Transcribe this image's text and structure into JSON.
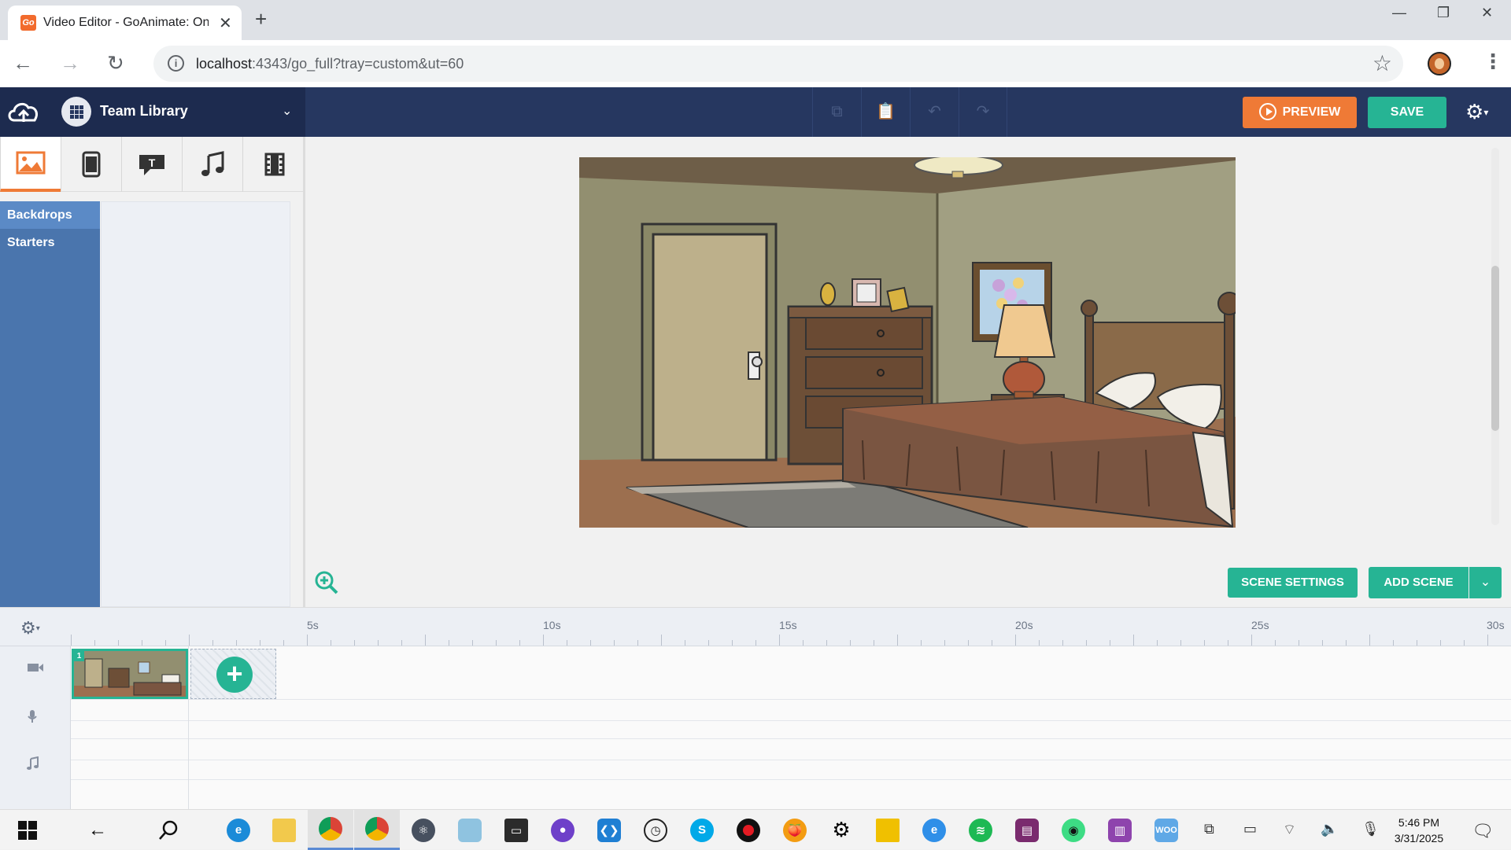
{
  "browser": {
    "tab_title": "Video Editor - GoAnimate: Online Animation",
    "favicon_text": "Go",
    "url_host": "localhost",
    "url_rest": ":4343/go_full?tray=custom&ut=60"
  },
  "header": {
    "library_title": "Team Library",
    "preview_label": "PREVIEW",
    "save_label": "SAVE",
    "colors": {
      "preview": "#ef7a36",
      "save": "#26b494",
      "header_bg": "#263760"
    }
  },
  "asset_panel": {
    "tabs": [
      {
        "name": "backgrounds",
        "icon": "image-icon"
      },
      {
        "name": "props",
        "icon": "tablet-icon"
      },
      {
        "name": "text",
        "icon": "speech-bubble-icon"
      },
      {
        "name": "audio",
        "icon": "music-note-icon"
      },
      {
        "name": "video",
        "icon": "film-icon"
      }
    ],
    "categories": [
      "Backdrops",
      "Starters"
    ]
  },
  "stage": {
    "scene_settings_label": "SCENE SETTINGS",
    "add_scene_label": "ADD SCENE"
  },
  "timeline": {
    "ticks": [
      "5s",
      "10s",
      "15s",
      "20s",
      "25s",
      "30s"
    ],
    "scene_number": "1",
    "tracks": [
      {
        "name": "video",
        "icon": "camera-icon"
      },
      {
        "name": "voice",
        "icon": "microphone-icon"
      },
      {
        "name": "music",
        "icon": "music-note-icon"
      }
    ]
  },
  "taskbar": {
    "time": "5:46 PM",
    "date": "3/31/2025"
  }
}
